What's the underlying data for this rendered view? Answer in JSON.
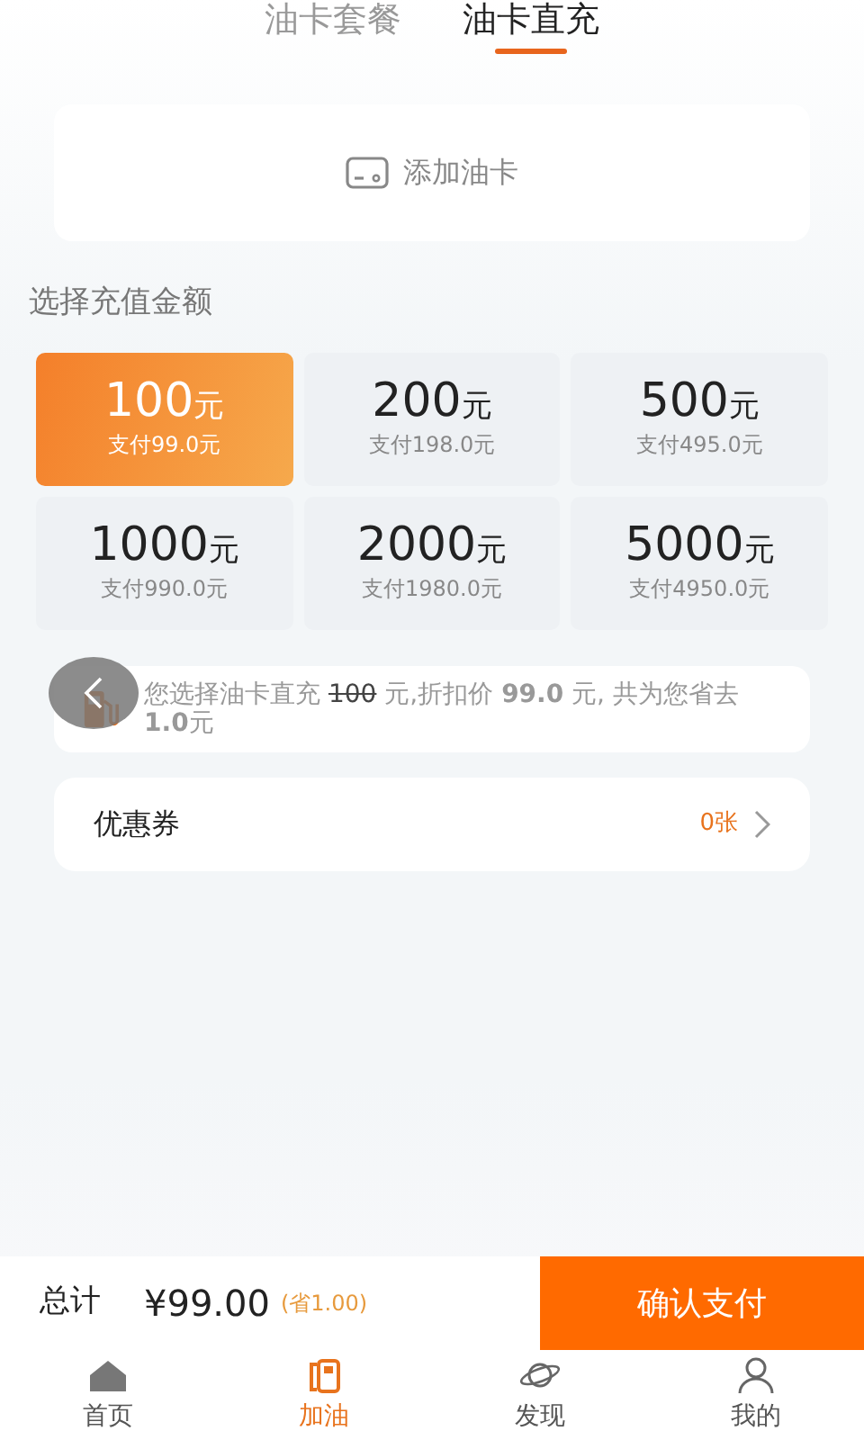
{
  "tabs": [
    {
      "label": "油卡套餐",
      "selected": false
    },
    {
      "label": "油卡直充",
      "selected": true
    }
  ],
  "add_card": {
    "label": "添加油卡"
  },
  "section_title": "选择充值金额",
  "amounts": [
    {
      "amount": "100",
      "unit": "元",
      "pay": "支付99.0元",
      "selected": true
    },
    {
      "amount": "200",
      "unit": "元",
      "pay": "支付198.0元",
      "selected": false
    },
    {
      "amount": "500",
      "unit": "元",
      "pay": "支付495.0元",
      "selected": false
    },
    {
      "amount": "1000",
      "unit": "元",
      "pay": "支付990.0元",
      "selected": false
    },
    {
      "amount": "2000",
      "unit": "元",
      "pay": "支付1980.0元",
      "selected": false
    },
    {
      "amount": "5000",
      "unit": "元",
      "pay": "支付4950.0元",
      "selected": false
    }
  ],
  "summary": {
    "parts": [
      {
        "kind": "plain",
        "text": "您选择油卡直充 "
      },
      {
        "kind": "struck",
        "text": "100"
      },
      {
        "kind": "plain",
        "text": " 元,折扣价 **99.0** 元, 共为您省去 **1.0**元"
      }
    ]
  },
  "coupon": {
    "label": "优惠券",
    "count": "0张"
  },
  "footer": {
    "total_label": "总计",
    "total": "¥99.00",
    "saving": "(省1.00)",
    "pay_button": "确认支付"
  },
  "nav": [
    {
      "kind": "home",
      "label": "首页",
      "selected": false
    },
    {
      "kind": "fuel",
      "label": "加油",
      "selected": true
    },
    {
      "kind": "planet",
      "label": "发现",
      "selected": false
    },
    {
      "kind": "person",
      "label": "我的",
      "selected": false
    }
  ]
}
